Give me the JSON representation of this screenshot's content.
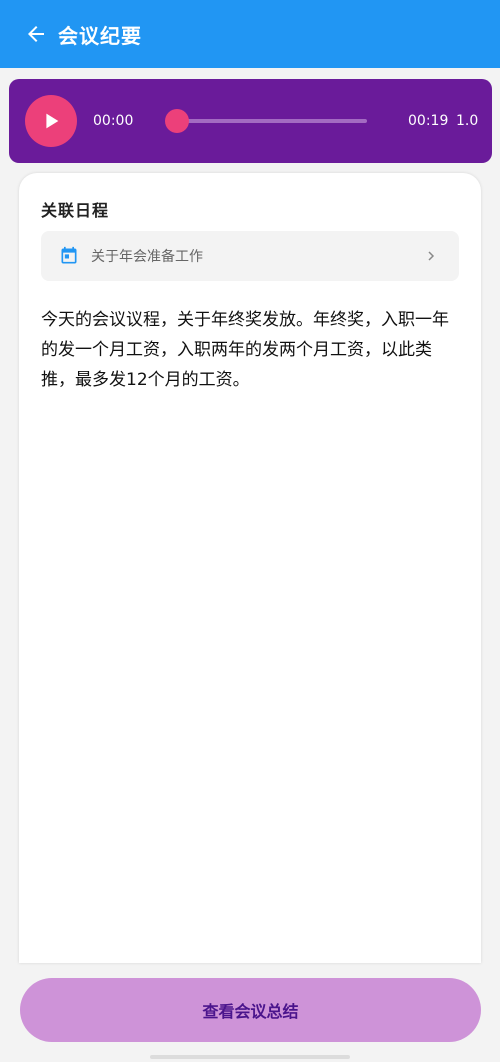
{
  "appbar": {
    "title": "会议纪要",
    "color": "#2196f3"
  },
  "player": {
    "current_time": "00:00",
    "total_time": "00:19",
    "speed": "1.0",
    "progress": 0.02,
    "accent": "#ec407a",
    "background": "#6a1b9a"
  },
  "schedule": {
    "section_title": "关联日程",
    "item_label": "关于年会准备工作"
  },
  "notes": {
    "text": "今天的会议议程，关于年终奖发放。年终奖，入职一年的发一个月工资，入职两年的发两个月工资，以此类推，最多发12个月的工资。"
  },
  "footer": {
    "summary_button_label": "查看会议总结",
    "button_color": "#ce93d8"
  },
  "icons": [
    "back-arrow-icon",
    "play-icon",
    "calendar-icon",
    "chevron-right-icon"
  ]
}
